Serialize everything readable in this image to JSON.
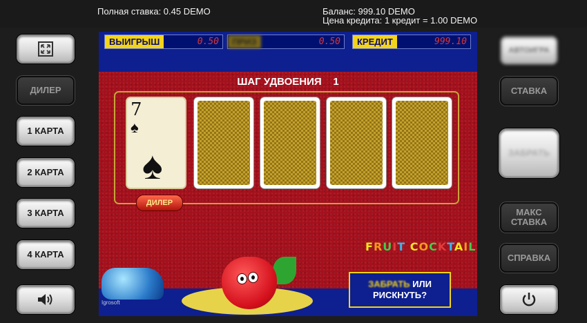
{
  "header": {
    "total_bet": "Полная ставка: 0.45 DEMO",
    "balance": "Баланс: 999.10 DEMO",
    "credit_price": "Цена кредита: 1 кредит = 1.00 DEMO"
  },
  "left_panel": {
    "fullscreen_icon": "fullscreen-icon",
    "dealer_label": "ДИЛЕР",
    "card1_label": "1 КАРТА",
    "card2_label": "2 КАРТА",
    "card3_label": "3 КАРТА",
    "card4_label": "4 КАРТА",
    "sound_icon": "speaker-icon"
  },
  "right_panel": {
    "autoplay_label": "АВТОИГРА",
    "bet_label": "СТАВКА",
    "collect_label": "ЗАБРАТЬ",
    "max_bet_label_line1": "МАКС",
    "max_bet_label_line2": "СТАВКА",
    "help_label": "СПРАВКА",
    "power_icon": "power-icon"
  },
  "hud": {
    "win_label": "ВЫИГРЫШ",
    "win_value": "0.50",
    "prize_label": "ПРИЗ",
    "prize_value": "0.50",
    "credit_label": "КРЕДИТ",
    "credit_value": "999.10"
  },
  "gamble": {
    "step_title": "ШАГ УДВОЕНИЯ",
    "step_number": "1",
    "dealer_badge": "ДИЛЕР",
    "dealer_card": {
      "rank": "7",
      "suit": "♠"
    },
    "face_down_cards": 4,
    "logo_text": "FRUIT COCKTAIL",
    "logo_colors": [
      "#f7e81c",
      "#f29a1c",
      "#3ed14a",
      "#e53b3b",
      "#36b9f0"
    ],
    "message_highlight": "ЗАБРАТЬ",
    "message_rest_line1": " ИЛИ",
    "message_line2": "РИСКНУТЬ?",
    "ice_caption": "Igrosoft"
  },
  "colors": {
    "felt": "#a4101c",
    "hud_label_bg": "#f2d41a",
    "hud_value": "#d93535",
    "game_bg": "#0e1f8f"
  }
}
